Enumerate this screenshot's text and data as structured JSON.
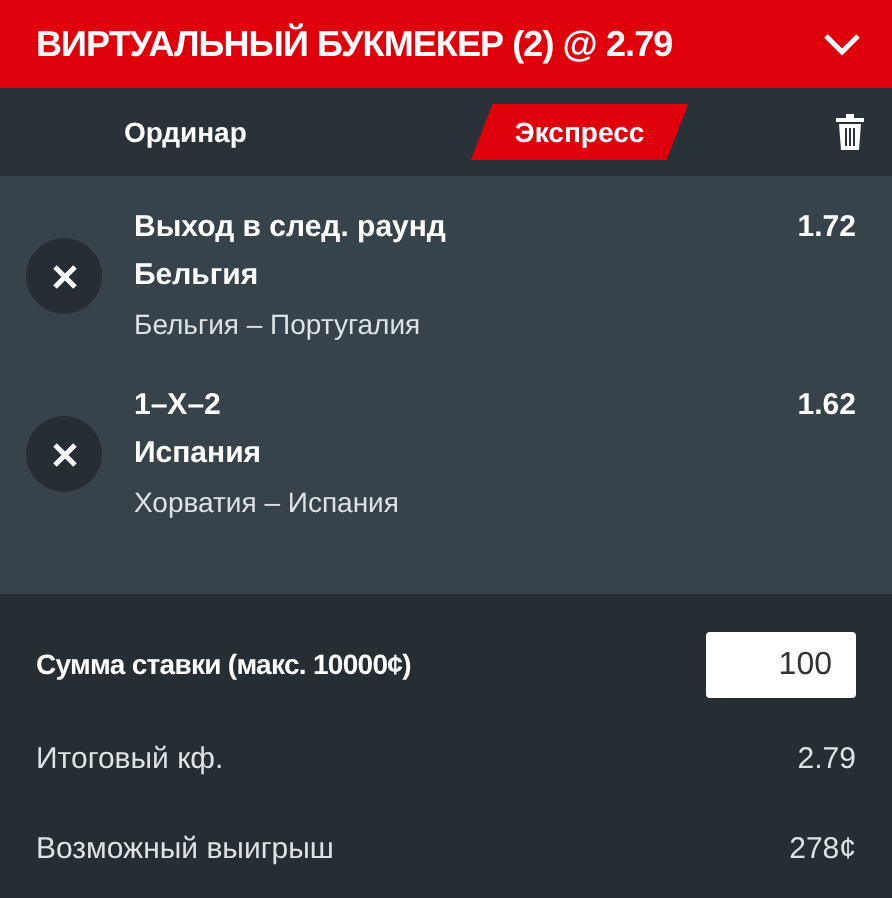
{
  "header": {
    "title": "ВИРТУАЛЬНЫЙ БУКМЕКЕР (2) @ 2.79",
    "expanded": true
  },
  "tabs": [
    {
      "label": "Ординар",
      "selected": false
    },
    {
      "label": "Экспресс",
      "selected": true
    }
  ],
  "bets": [
    {
      "market": "Выход в след. раунд",
      "selection": "Бельгия",
      "match": "Бельгия – Португалия",
      "odds": "1.72"
    },
    {
      "market": "1–X–2",
      "selection": "Испания",
      "match": "Хорватия – Испания",
      "odds": "1.62"
    }
  ],
  "stake": {
    "label": "Сумма ставки (макс. 10000¢)",
    "value": "100"
  },
  "summary": [
    {
      "label": "Итоговый кф.",
      "value": "2.79"
    },
    {
      "label": "Возможный выигрыш",
      "value": "278¢"
    }
  ]
}
